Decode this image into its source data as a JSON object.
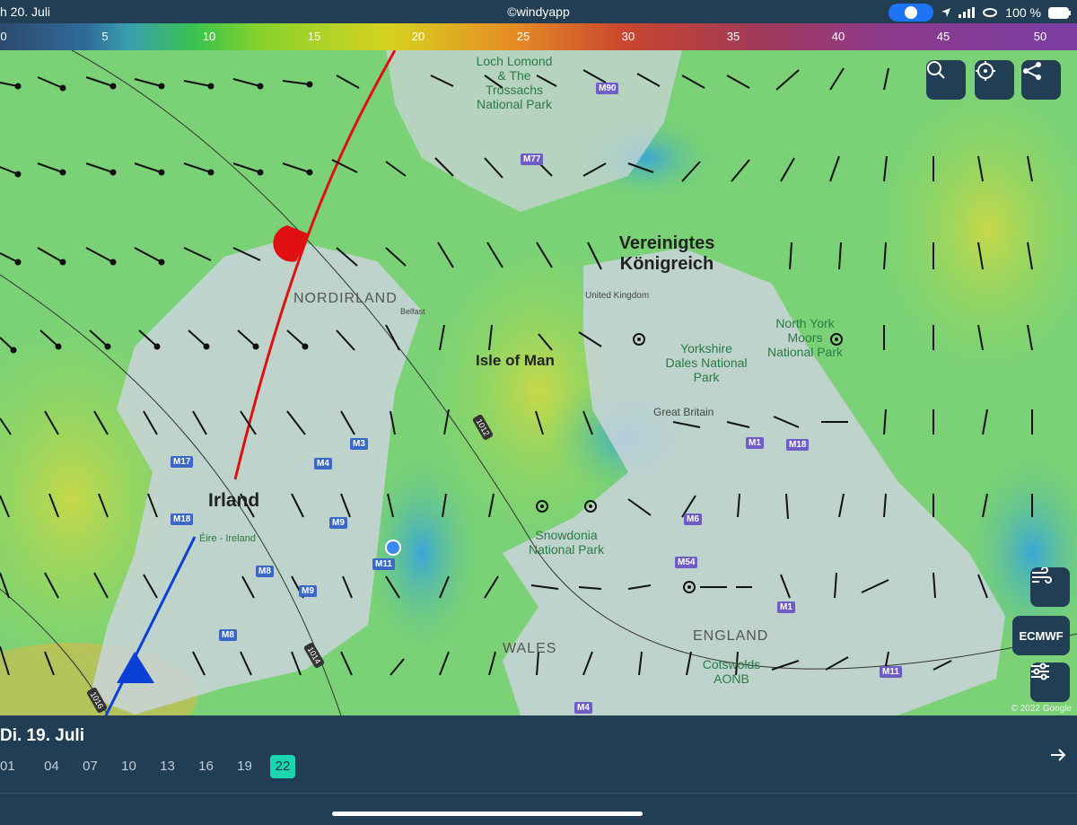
{
  "status_bar": {
    "date_left": "h 20. Juli",
    "center_text": "©windyapp",
    "battery": "100 %"
  },
  "wind_scale": {
    "ticks": [
      "0",
      "5",
      "10",
      "15",
      "20",
      "25",
      "30",
      "35",
      "40",
      "45",
      "50"
    ]
  },
  "map": {
    "labels": {
      "loch_lomond": "Loch Lomond & The Trossachs National Park",
      "vereinigtes": "Vereinigtes Königreich",
      "nordirland": "NORDIRLAND",
      "isle_of_man": "Isle of Man",
      "irland": "Irland",
      "eire": "Éire - Ireland",
      "united_kingdom": "United Kingdom",
      "north_york": "North York Moors National Park",
      "yorkshire": "Yorkshire Dales National Park",
      "great_britain": "Great Britain",
      "snowdonia": "Snowdonia National Park",
      "wales": "WALES",
      "england": "ENGLAND",
      "cotswolds": "Cotswolds AONB",
      "belfast": "Belfast"
    },
    "isobars": [
      "1012",
      "1014",
      "1016"
    ],
    "roads": [
      "M90",
      "M77",
      "M3",
      "M4",
      "M17",
      "M18",
      "M9",
      "M8",
      "M11",
      "M9",
      "M8",
      "M1",
      "M18",
      "M6",
      "M54",
      "M1",
      "M11",
      "M4"
    ],
    "copyright": "© 2022 Google"
  },
  "controls": {
    "search_icon": "search-icon",
    "locate_icon": "locate-icon",
    "share_icon": "share-icon",
    "wind_layer_icon": "wind-icon",
    "model_label": "ECMWF",
    "settings_icon": "sliders-icon"
  },
  "timeline": {
    "date": "Di. 19. Juli",
    "hours": [
      "01",
      "04",
      "07",
      "10",
      "13",
      "16",
      "19",
      "22"
    ],
    "selected": "22",
    "next_icon": "arrow-right-icon"
  },
  "colors": {
    "bar": "#223e54",
    "selected_hour": "#1ad6b0",
    "warm_front": "#e01010",
    "cold_front": "#0a3fd8"
  }
}
